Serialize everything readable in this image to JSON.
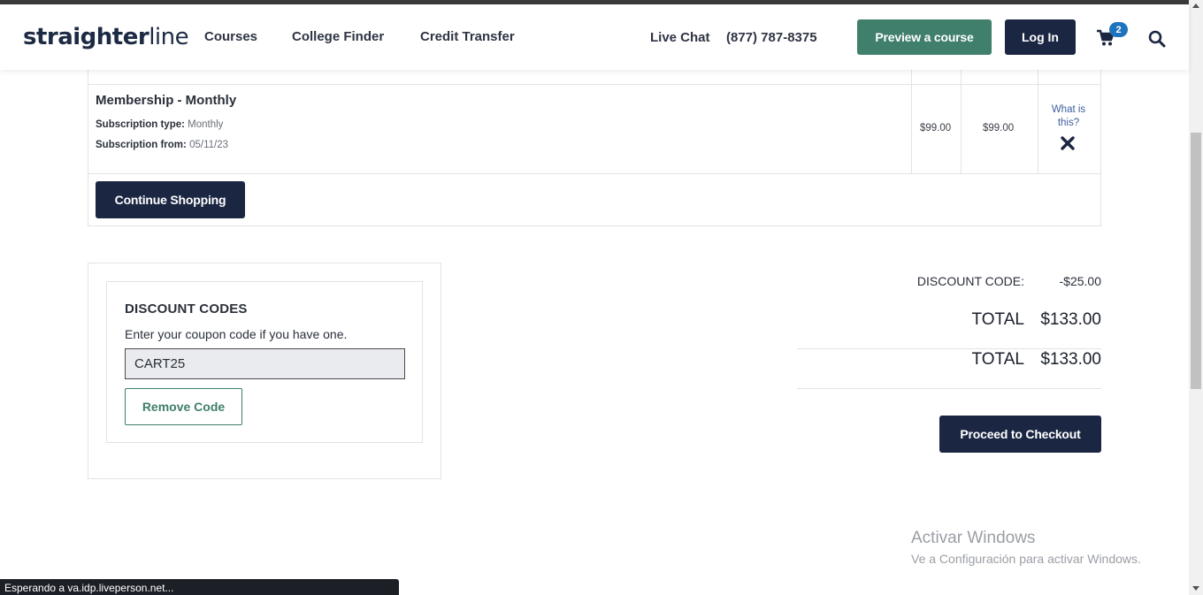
{
  "header": {
    "logo_bold": "straighter",
    "logo_light": "line",
    "nav": [
      "Courses",
      "College Finder",
      "Credit Transfer"
    ],
    "live_chat": "Live Chat",
    "phone": "(877) 787-8375",
    "preview_button": "Preview a course",
    "login_button": "Log In",
    "cart_count": "2",
    "icons": {
      "cart": "cart-icon",
      "search": "search-icon"
    }
  },
  "cart_item": {
    "title": "Membership - Monthly",
    "subscription_type_label": "Subscription type:",
    "subscription_type_value": "Monthly",
    "subscription_from_label": "Subscription from:",
    "subscription_from_value": "05/11/23",
    "unit_price": "$99.00",
    "subtotal": "$99.00",
    "what_is_this": "What is this?",
    "continue_button": "Continue Shopping"
  },
  "discount": {
    "title": "DISCOUNT CODES",
    "subtitle": "Enter your coupon code if you have one.",
    "code_value": "CART25",
    "remove_button": "Remove Code"
  },
  "totals": {
    "discount_label": "DISCOUNT CODE:",
    "discount_value": "-$25.00",
    "total_label": "TOTAL",
    "total_value": "$133.00",
    "grand_total_label": "TOTAL",
    "grand_total_value": "$133.00",
    "checkout_button": "Proceed to Checkout"
  },
  "watermark": {
    "title": "Activar Windows",
    "subtitle": "Ve a Configuración para activar Windows."
  },
  "status_bar": "Esperando a va.idp.liveperson.net...",
  "colors": {
    "navy": "#1b2642",
    "green": "#3f7f6b",
    "badge_blue": "#1e73be"
  }
}
